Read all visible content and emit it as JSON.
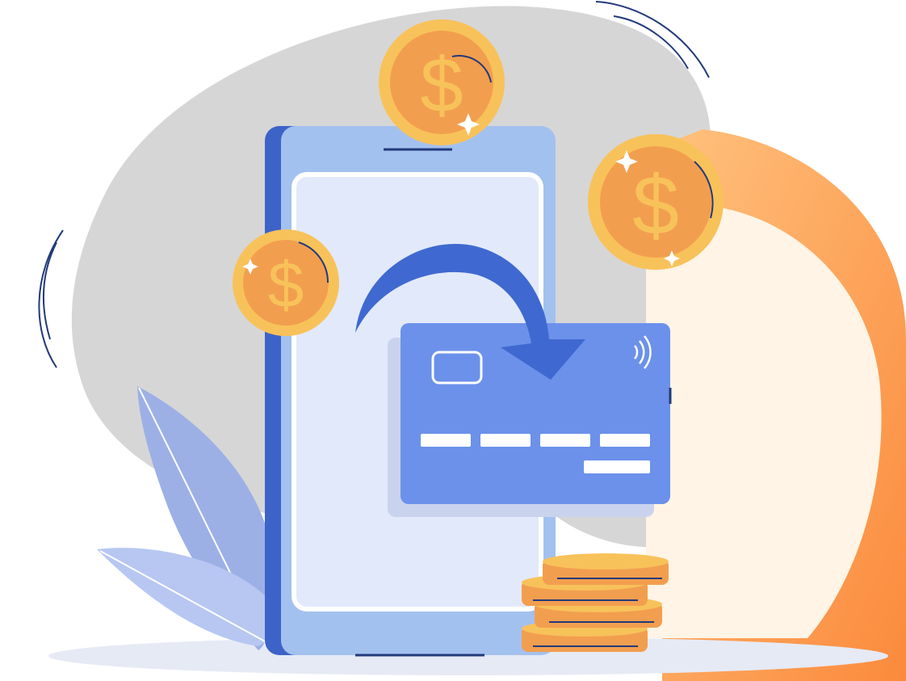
{
  "illustration": {
    "subject": "mobile-payment-to-card",
    "coin_symbol": "$",
    "coin_count": 3,
    "stack_coin_count": 4,
    "card_number_groups": 4,
    "icons": {
      "phone": "smartphone-icon",
      "card": "credit-card-icon",
      "chip": "card-chip-icon",
      "contactless": "contactless-icon",
      "arrow": "transfer-arrow-icon",
      "coin": "dollar-coin-icon",
      "plant": "leaf-icon"
    }
  },
  "colors": {
    "blob": "#d6d6d6",
    "ring": "#fb8e45",
    "ring_light": "#ffbe78",
    "ring_inner": "#fff4e5",
    "phone_body": "#a3c1ef",
    "phone_edge": "#3d63c9",
    "phone_screen": "#e2e9fb",
    "card": "#6b91ea",
    "card_shadow": "#c9d3ee",
    "arrow": "#3f69d0",
    "coin_outer": "#f8c25a",
    "coin_inner": "#f29e4f",
    "coin_symbol": "#f8c25a",
    "outline": "#223a7a",
    "leaf": "#9db0e6",
    "leaf_light": "#b7c7f2",
    "floor": "#e6eaf5"
  }
}
